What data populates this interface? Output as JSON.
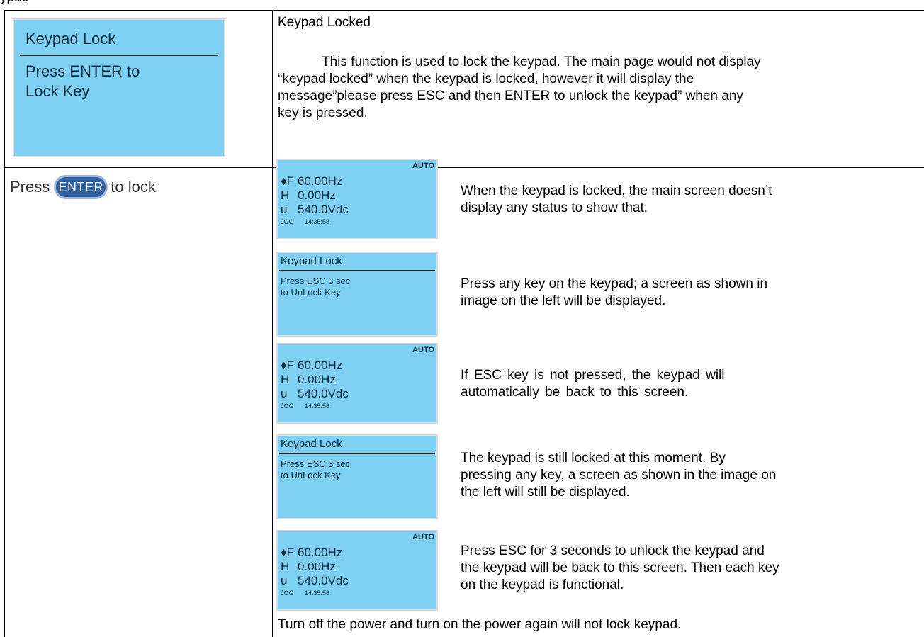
{
  "header_fragment": "ypad",
  "left": {
    "lcd": {
      "title": "Keypad Lock",
      "line1": "Press ENTER to",
      "line2": "Lock Key"
    },
    "press": {
      "prefix": "Press",
      "button": "ENTER",
      "suffix": "to lock"
    }
  },
  "right": {
    "heading": "Keypad Locked",
    "intro": [
      "This function is used to lock the keypad. The main page would not display",
      "“keypad locked” when the keypad is locked, however it will display the",
      "message”please press ESC and then ENTER to unlock the keypad” when any",
      "key is pressed."
    ],
    "main_screen": {
      "auto": "AUTO",
      "f_key": "♦F",
      "f_val": "60.00Hz",
      "h_key": "H",
      "h_val": "0.00Hz",
      "u_key": "u",
      "u_val": "540.0Vdc",
      "jog": "JOG",
      "clock": "14:35:58"
    },
    "lock_screen": {
      "title": "Keypad Lock",
      "line1": "Press ESC 3 sec",
      "line2": "to UnLock Key"
    },
    "steps": [
      {
        "lines": [
          "When the keypad is locked, the main screen doesn’t",
          "display any status to show that."
        ]
      },
      {
        "lines": [
          "Press any key on the keypad; a screen as shown in",
          "image on the left will be displayed."
        ]
      },
      {
        "lines": [
          "If  ESC  key  is  not  pressed,  the  keypad  will",
          "automatically be back to this screen."
        ]
      },
      {
        "lines": [
          "The  keypad  is  still  locked  at  this  moment.  By",
          "pressing any key, a screen as shown in the image on",
          "the left will still be displayed."
        ]
      },
      {
        "lines": [
          "Press ESC for 3 seconds to unlock the keypad and",
          "the keypad will be back to this screen. Then each key",
          "on the keypad is functional."
        ]
      }
    ],
    "footer": "Turn off the power and turn on the power again will not lock keypad."
  }
}
